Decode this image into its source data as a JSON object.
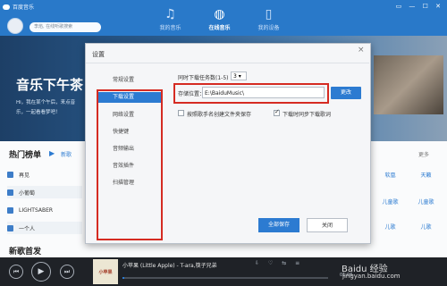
{
  "app": {
    "title": "百度音乐"
  },
  "header": {
    "search_placeholder": "李焰, 在线听歌搜索",
    "tabs": [
      {
        "label": "我的音乐"
      },
      {
        "label": "在线音乐"
      },
      {
        "label": "我的设备"
      }
    ],
    "window_controls": "▭ — ☐ ✕"
  },
  "banner": {
    "title": "音乐下午茶",
    "desc": "Hi，我在某个午后，来点音乐，一起看看梦吧！"
  },
  "list": {
    "hot_title": "热门榜单",
    "new_label": "新歌",
    "more": "更多",
    "rows": [
      {
        "label": "再见"
      },
      {
        "label": "小葡萄"
      },
      {
        "label": "LIGHTSABER"
      },
      {
        "label": "一个人"
      }
    ],
    "right_cols": [
      {
        "a": "软凰",
        "b": "天籁"
      },
      {
        "a": "儿童歌",
        "b": "儿童歌"
      },
      {
        "a": "儿歌",
        "b": "儿歌"
      }
    ],
    "new_release_title": "新歌首发"
  },
  "player": {
    "track": "小苹果 (Little Apple) - T-ara,筷子兄弟",
    "cover_text": "小苹果",
    "time": "01:06",
    "progress": 0.01
  },
  "watermark": {
    "line1": "Baidu 经验",
    "line2": "jingyan.baidu.com"
  },
  "dialog": {
    "title": "设置",
    "close": "×",
    "sidebar": [
      {
        "label": "常规设置"
      },
      {
        "label": "下载设置"
      },
      {
        "label": "网络设置"
      },
      {
        "label": "快捷键"
      },
      {
        "label": "音频输出"
      },
      {
        "label": "音效插件"
      },
      {
        "label": "扫描管理"
      }
    ],
    "concurrent_label": "同时下载任务数(1-5)",
    "concurrent_value": "3",
    "path_label": "存储位置：",
    "path_value": "E:\\BaiduMusic\\",
    "change_button": "更改",
    "checkbox1_label": "按照歌手名创建文件夹保存",
    "checkbox2_label": "下载时同步下载歌词",
    "save_button": "全部保存",
    "close_button": "关闭"
  },
  "colors": {
    "accent": "#2c7bd1",
    "header": "#2979c9",
    "highlight": "#d52b22"
  }
}
